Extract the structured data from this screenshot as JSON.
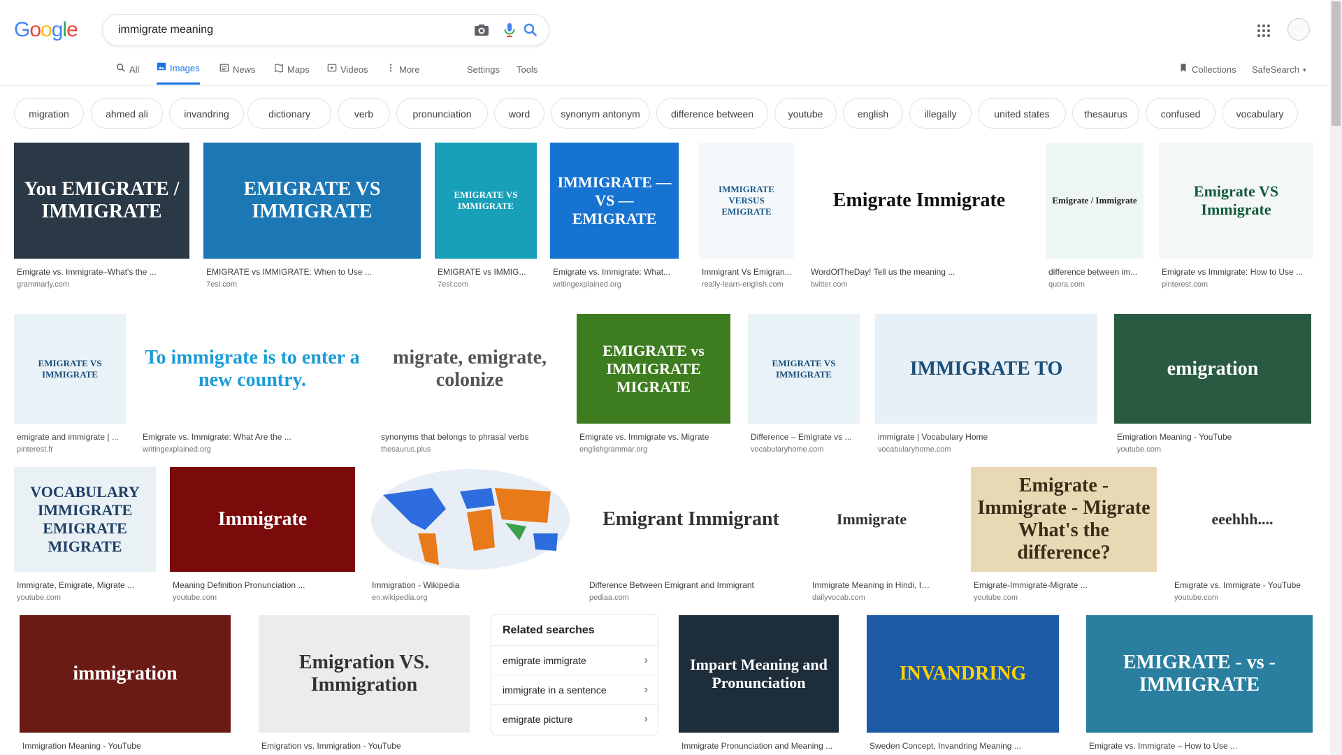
{
  "logo": {
    "text": "Google",
    "letters": [
      {
        "ch": "G",
        "color": "#4285f4"
      },
      {
        "ch": "o",
        "color": "#ea4335"
      },
      {
        "ch": "o",
        "color": "#fbbc05"
      },
      {
        "ch": "g",
        "color": "#4285f4"
      },
      {
        "ch": "l",
        "color": "#34a853"
      },
      {
        "ch": "e",
        "color": "#ea4335"
      }
    ]
  },
  "search": {
    "value": "immigrate meaning"
  },
  "tabs": [
    {
      "label": "All",
      "icon": "search-icon"
    },
    {
      "label": "Images",
      "icon": "image-icon",
      "active": true
    },
    {
      "label": "News",
      "icon": "news-icon"
    },
    {
      "label": "Maps",
      "icon": "map-icon"
    },
    {
      "label": "Videos",
      "icon": "video-icon"
    },
    {
      "label": "More",
      "icon": "more-vert-icon"
    },
    {
      "label": "Settings"
    },
    {
      "label": "Tools"
    }
  ],
  "right_tabs": {
    "collections": "Collections",
    "safesearch": "SafeSearch"
  },
  "chips": [
    "migration",
    "ahmed ali",
    "invandring",
    "dictionary",
    "verb",
    "pronunciation",
    "word",
    "synonym antonym",
    "difference between",
    "youtube",
    "english",
    "illegally",
    "united states",
    "thesaurus",
    "confused",
    "vocabulary"
  ],
  "results": [
    {
      "caption": "Emigrate vs. Immigrate–What's the ...",
      "source": "grammarly.com",
      "thumb_text": "You EMIGRATE / IMMIGRATE",
      "bg": "#2b3947",
      "fg": "#ffffff"
    },
    {
      "caption": "EMIGRATE vs IMMIGRATE: When to Use ...",
      "source": "7esl.com",
      "thumb_text": "EMIGRATE VS IMMIGRATE",
      "bg": "#1c78b4",
      "fg": "#ffffff"
    },
    {
      "caption": "EMIGRATE vs IMMIG...",
      "source": "7esl.com",
      "thumb_text": "EMIGRATE VS IMMIGRATE",
      "bg": "#18a0b8",
      "fg": "#ffffff"
    },
    {
      "caption": "Emigrate vs. Immigrate: What...",
      "source": "writingexplained.org",
      "thumb_text": "IMMIGRATE — VS — EMIGRATE",
      "bg": "#1773d1",
      "fg": "#ffffff"
    },
    {
      "caption": "Immigrant Vs Emigran...",
      "source": "really-learn-english.com",
      "thumb_text": "IMMIGRATE VERSUS EMIGRATE",
      "bg": "#f4f8fb",
      "fg": "#1e5a8a"
    },
    {
      "caption": "WordOfTheDay! Tell us the meaning ...",
      "source": "twitter.com",
      "thumb_text": "Emigrate   Immigrate",
      "bg": "#ffffff",
      "fg": "#111111"
    },
    {
      "caption": "difference between im...",
      "source": "quora.com",
      "thumb_text": "Emigrate / Immigrate",
      "bg": "#eef6f6",
      "fg": "#222222"
    },
    {
      "caption": "Emigrate vs Immigrate: How to Use ...",
      "source": "pinterest.com",
      "thumb_text": "Emigrate VS Immigrate",
      "bg": "#f3f7f5",
      "fg": "#125a3c"
    },
    {
      "caption": "emigrate and immigrate | ...",
      "source": "pinterest.fr",
      "thumb_text": "EMIGRATE VS IMMIGRATE",
      "bg": "#e9f2f7",
      "fg": "#1b4f7a"
    },
    {
      "caption": "Emigrate vs. Immigrate: What Are the ...",
      "source": "writingexplained.org",
      "thumb_text": "To immigrate is to enter a new country.",
      "bg": "#ffffff",
      "fg": "#1a9cd8"
    },
    {
      "caption": "synonyms that belongs to phrasal verbs",
      "source": "thesaurus.plus",
      "thumb_text": "migrate, emigrate, colonize",
      "bg": "#ffffff",
      "fg": "#555555"
    },
    {
      "caption": "Emigrate vs. Immigrate vs. Migrate",
      "source": "englishgrammar.org",
      "thumb_text": "EMIGRATE vs IMMIGRATE MIGRATE",
      "bg": "#3e7d1f",
      "fg": "#ffffff"
    },
    {
      "caption": "Difference – Emigrate vs ...",
      "source": "vocabularyhome.com",
      "thumb_text": "EMIGRATE VS IMMIGRATE",
      "bg": "#e9f2f7",
      "fg": "#1b4f7a"
    },
    {
      "caption": "immigrate | Vocabulary Home",
      "source": "vocabularyhome.com",
      "thumb_text": "IMMIGRATE TO",
      "bg": "#e7f0f6",
      "fg": "#1b4f7a"
    },
    {
      "caption": "Emigration Meaning - YouTube",
      "source": "youtube.com",
      "thumb_text": "emigration",
      "bg": "#2a5a41",
      "fg": "#ffffff"
    },
    {
      "caption": "Immigrate, Emigrate, Migrate ...",
      "source": "youtube.com",
      "thumb_text": "VOCABULARY IMMIGRATE EMIGRATE MIGRATE",
      "bg": "#eaf1f5",
      "fg": "#1f3f66"
    },
    {
      "caption": "Meaning Definition Pronunciation ...",
      "source": "youtube.com",
      "thumb_text": "Immigrate",
      "bg": "#7b0b0b",
      "fg": "#ffffff"
    },
    {
      "caption": "Immigration - Wikipedia",
      "source": "en.wikipedia.org",
      "thumb_text": "",
      "bg": "#ffffff",
      "fg": "#000000"
    },
    {
      "caption": "Difference Between Emigrant and Immigrant",
      "source": "pediaa.com",
      "thumb_text": "Emigrant   Immigrant",
      "bg": "#ffffff",
      "fg": "#333333"
    },
    {
      "caption": "Immigrate Meaning in Hindi, Immig...",
      "source": "dailyvocab.com",
      "thumb_text": "Immigrate",
      "bg": "#ffffff",
      "fg": "#333333"
    },
    {
      "caption": "Emigrate-Immigrate-Migrate ...",
      "source": "youtube.com",
      "thumb_text": "Emigrate - Immigrate - Migrate What's the difference?",
      "bg": "#e8d9b5",
      "fg": "#3a2d17"
    },
    {
      "caption": "Emigrate vs. Immigrate - YouTube",
      "source": "youtube.com",
      "thumb_text": "eeehhh....",
      "bg": "#ffffff",
      "fg": "#333333"
    },
    {
      "caption": "Immigration Meaning - YouTube",
      "source": "youtube.com",
      "thumb_text": "immigration",
      "bg": "#6a1b14",
      "fg": "#ffffff"
    },
    {
      "caption": "Emigration vs. Immigration - YouTube",
      "source": "",
      "thumb_text": "Emigration VS. Immigration",
      "bg": "#ececec",
      "fg": "#333333"
    },
    {
      "caption": "Immigrate Pronunciation and Meaning ...",
      "source": "",
      "thumb_text": "Impart Meaning and Pronunciation",
      "bg": "#1e2d3a",
      "fg": "#ffffff"
    },
    {
      "caption": "Sweden Concept, Invandring Meaning ...",
      "source": "",
      "thumb_text": "INVANDRING",
      "bg": "#1c5aa6",
      "fg": "#ffd100"
    },
    {
      "caption": "Emigrate vs. Immigrate – How to Use ...",
      "source": "",
      "thumb_text": "EMIGRATE - vs - IMMIGRATE",
      "bg": "#2a7ea0",
      "fg": "#ffffff"
    }
  ],
  "related": {
    "title": "Related searches",
    "items": [
      "emigrate immigrate",
      "immigrate in a sentence",
      "emigrate picture"
    ]
  }
}
